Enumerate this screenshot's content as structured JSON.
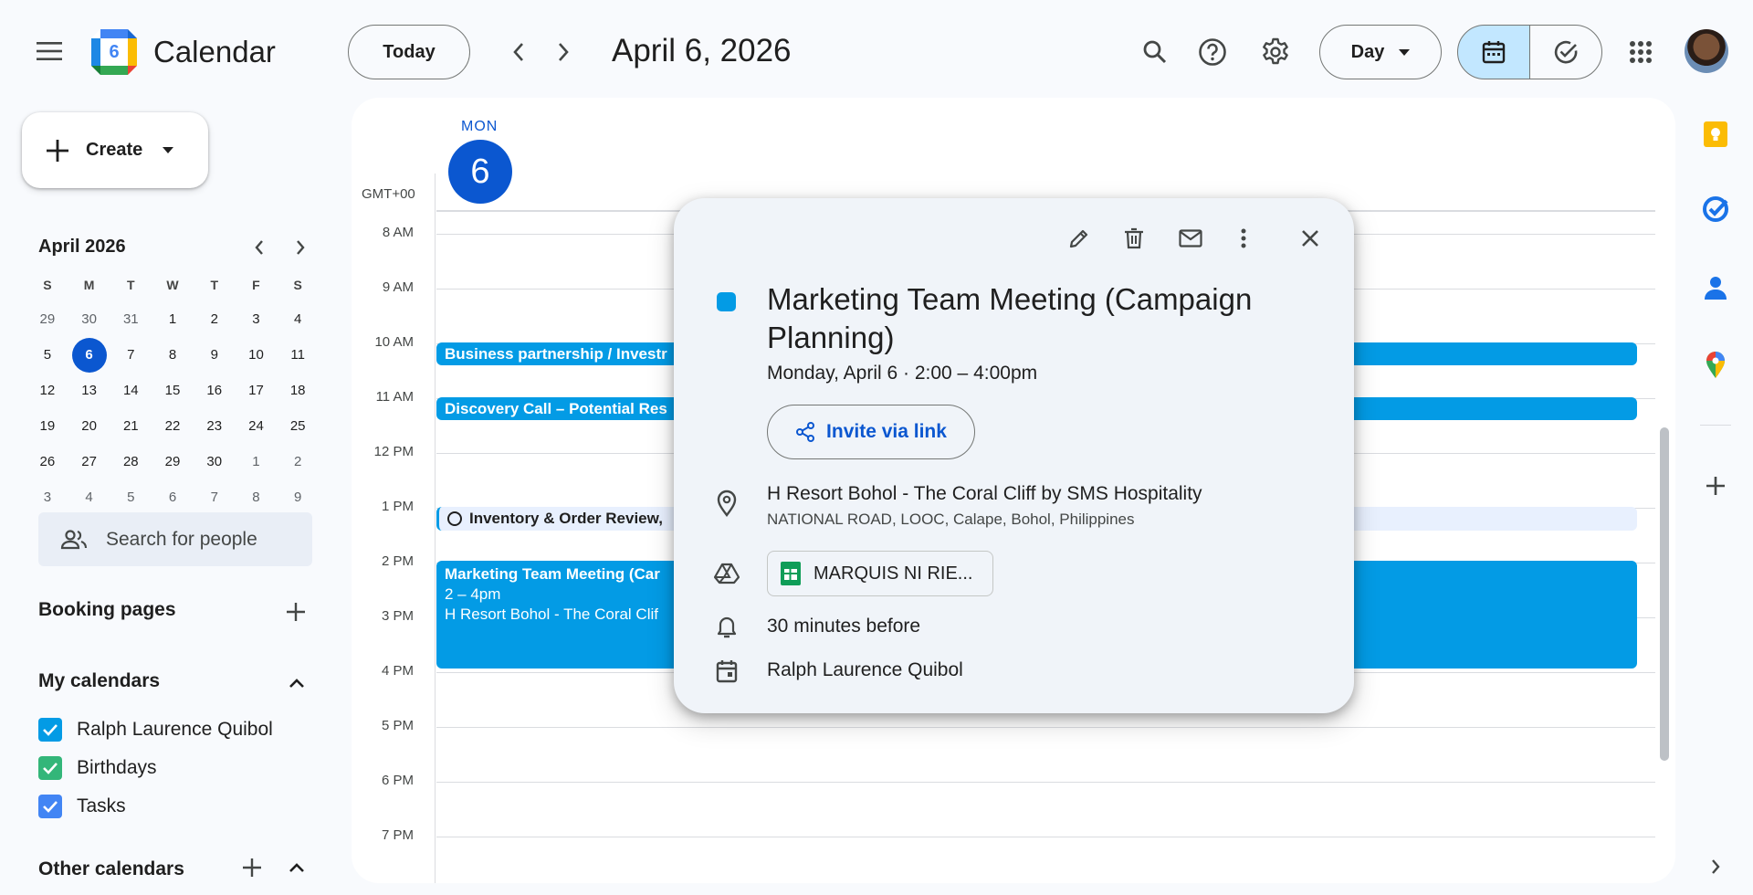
{
  "app": {
    "title": "Calendar",
    "logo_day": "6",
    "colors": {
      "primary": "#0b57d0",
      "event": "#039be5",
      "selected_view_bg": "#c2e7ff",
      "panel_bg": "#ffffff",
      "page_bg": "#f8fafd"
    }
  },
  "header": {
    "today_label": "Today",
    "current_date": "April 6, 2026",
    "view_select": "Day",
    "icons": [
      "menu-icon",
      "chevron-left-icon",
      "chevron-right-icon",
      "search-icon",
      "help-icon",
      "settings-icon",
      "calendar-view-icon",
      "tasks-view-icon",
      "apps-icon"
    ]
  },
  "sidebar": {
    "create_label": "Create",
    "mini_calendar": {
      "title": "April 2026",
      "weekdays": [
        "S",
        "M",
        "T",
        "W",
        "T",
        "F",
        "S"
      ],
      "weeks": [
        [
          "29",
          "30",
          "31",
          "1",
          "2",
          "3",
          "4"
        ],
        [
          "5",
          "6",
          "7",
          "8",
          "9",
          "10",
          "11"
        ],
        [
          "12",
          "13",
          "14",
          "15",
          "16",
          "17",
          "18"
        ],
        [
          "19",
          "20",
          "21",
          "22",
          "23",
          "24",
          "25"
        ],
        [
          "26",
          "27",
          "28",
          "29",
          "30",
          "1",
          "2"
        ],
        [
          "3",
          "4",
          "5",
          "6",
          "7",
          "8",
          "9"
        ]
      ],
      "selected": "6"
    },
    "search_people_placeholder": "Search for people",
    "booking_pages_label": "Booking pages",
    "my_calendars_label": "My calendars",
    "my_calendars": [
      {
        "name": "Ralph Laurence Quibol",
        "color": "#039be5",
        "checked": true
      },
      {
        "name": "Birthdays",
        "color": "#33b679",
        "checked": true
      },
      {
        "name": "Tasks",
        "color": "#4285f4",
        "checked": true
      }
    ],
    "other_calendars_label": "Other calendars"
  },
  "day_view": {
    "day_of_week": "MON",
    "day_number": "6",
    "timezone": "GMT+00",
    "hours": [
      "8 AM",
      "9 AM",
      "10 AM",
      "11 AM",
      "12 PM",
      "1 PM",
      "2 PM",
      "3 PM",
      "4 PM",
      "5 PM",
      "6 PM",
      "7 PM"
    ],
    "events": [
      {
        "title": "Business partnership / Investr"
      },
      {
        "title": "Discovery Call – Potential Res"
      },
      {
        "title": "Inventory & Order Review,"
      },
      {
        "title": "Marketing Team Meeting (Car",
        "time": "2 – 4pm",
        "location": "H Resort Bohol - The Coral Clif"
      }
    ]
  },
  "popup": {
    "title": "Marketing Team Meeting (Campaign Planning)",
    "when": "Monday, April 6  ·  2:00 – 4:00pm",
    "invite_label": "Invite via link",
    "location_name": "H Resort Bohol - The Coral Cliff by SMS Hospitality",
    "location_address": "NATIONAL ROAD, LOOC, Calape, Bohol, Philippines",
    "attachment": "MARQUIS NI RIE...",
    "reminder": "30 minutes before",
    "calendar_owner": "Ralph Laurence Quibol",
    "event_color": "#039be5"
  },
  "right_rail": {
    "icons": [
      "keep-icon",
      "tasks-icon",
      "contacts-icon",
      "maps-icon",
      "add-addon-icon",
      "chevron-right-icon"
    ]
  }
}
